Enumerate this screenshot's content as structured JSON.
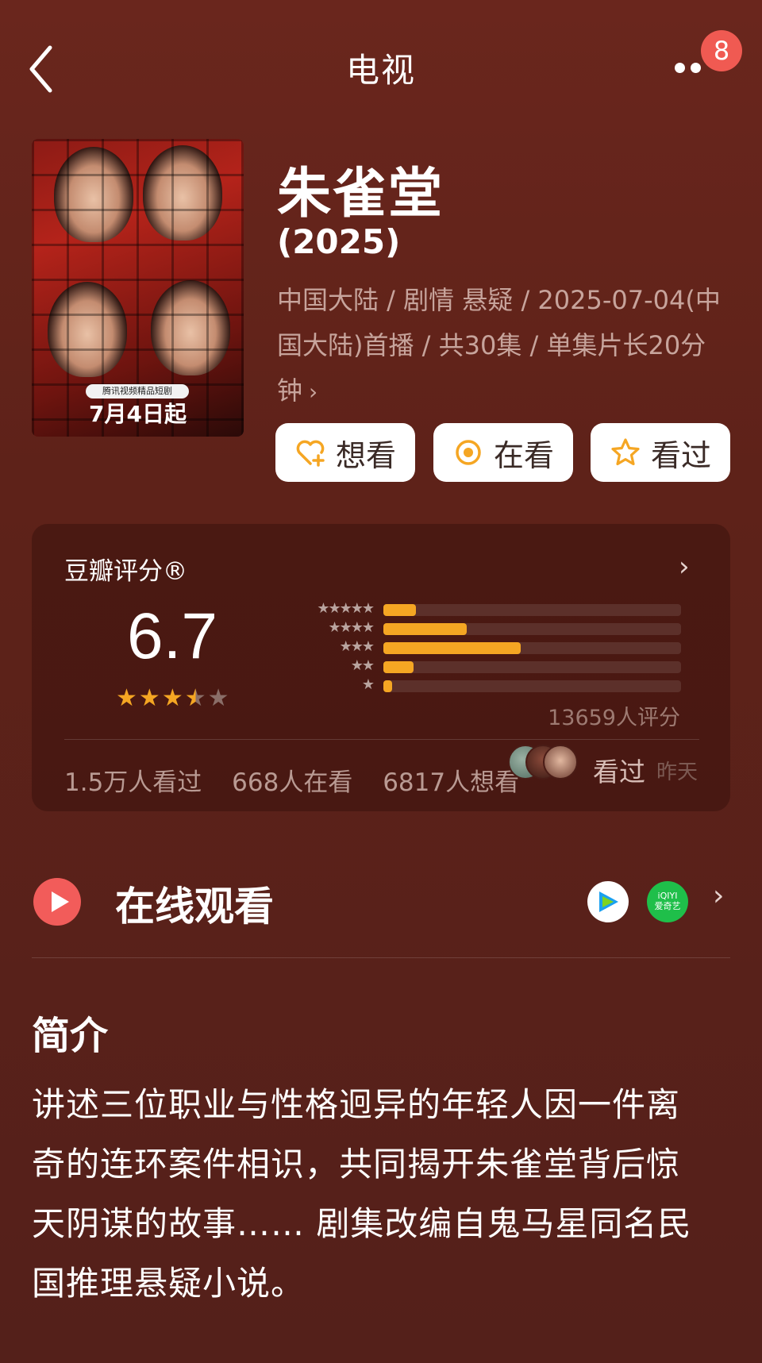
{
  "nav": {
    "title": "电视",
    "badge_count": "8"
  },
  "poster": {
    "ribbon_text": "腾讯视频精品短剧",
    "date_text": "7月4日起"
  },
  "title": "朱雀堂",
  "year": "(2025)",
  "meta": {
    "line1": "中国大陆 / 剧情 悬疑 / 2025-07-04(中",
    "line2": "国大陆)首播 / 共30集 / 单集片长20分",
    "line3": "钟",
    "chevron": "›"
  },
  "actions": [
    {
      "label": "想看",
      "icon": "heart-plus-icon"
    },
    {
      "label": "在看",
      "icon": "target-icon"
    },
    {
      "label": "看过",
      "icon": "star-outline-icon"
    }
  ],
  "rating": {
    "label": "豆瓣评分®",
    "score": "6.7",
    "stars_value": 3.5,
    "distribution": [
      {
        "stars": "★★★★★",
        "fraction": 0.11
      },
      {
        "stars": "★★★★",
        "fraction": 0.28
      },
      {
        "stars": "★★★",
        "fraction": 0.46
      },
      {
        "stars": "★★",
        "fraction": 0.1
      },
      {
        "stars": "★",
        "fraction": 0.03
      }
    ],
    "vote_count": "13659人评分",
    "stats": {
      "seen": "1.5万人看过",
      "watching": "668人在看",
      "want": "6817人想看"
    },
    "friend_status": "看过",
    "friend_time": "昨天",
    "colors": {
      "bar": "#f5a623",
      "star": "#f5a623"
    }
  },
  "watch": {
    "title": "在线观看",
    "platforms": [
      {
        "name": "tencent-video-icon"
      },
      {
        "name": "iqiyi-icon",
        "label_top": "iQIYI",
        "label_bottom": "爱奇艺"
      }
    ]
  },
  "intro": {
    "title": "简介",
    "lines": [
      "讲述三位职业与性格迥异的年轻人因一件离",
      "奇的连环案件相识，共同揭开朱雀堂背后惊",
      "天阴谋的故事…… 剧集改编自鬼马星同名民",
      "国推理悬疑小说。"
    ]
  }
}
